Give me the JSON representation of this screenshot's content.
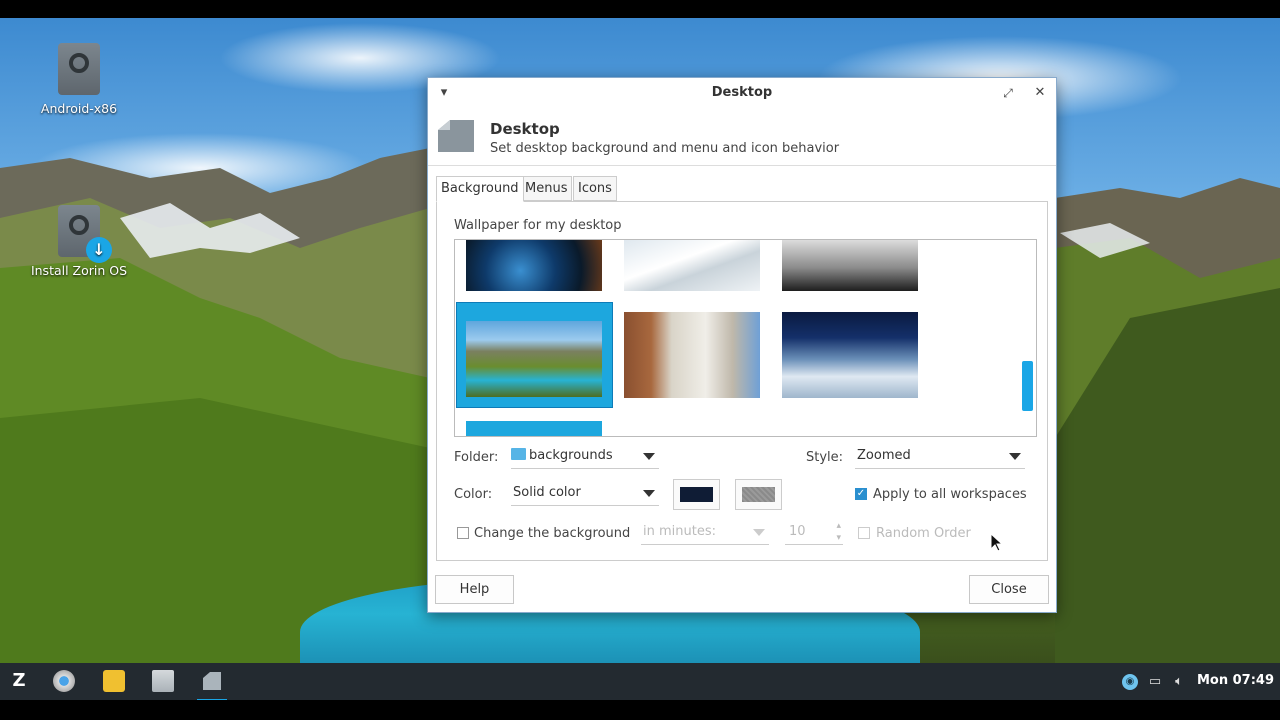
{
  "desktop": {
    "icons": [
      {
        "label": "Android-x86"
      },
      {
        "label": "Install Zorin OS"
      }
    ]
  },
  "window": {
    "title": "Desktop",
    "header_title": "Desktop",
    "header_subtitle": "Set desktop background and menu and icon behavior",
    "tabs": [
      {
        "label": "Background",
        "active": true
      },
      {
        "label": "Menus",
        "active": false
      },
      {
        "label": "Icons",
        "active": false
      }
    ],
    "background": {
      "wallpaper_label": "Wallpaper for my desktop",
      "folder_label": "Folder:",
      "folder_value": "backgrounds",
      "style_label": "Style:",
      "style_value": "Zoomed",
      "color_label": "Color:",
      "color_value": "Solid color",
      "primary_color": "#0f1c35",
      "secondary_color": "#8a8a8a",
      "apply_all_label": "Apply to all workspaces",
      "apply_all_checked": true,
      "change_bg_label": "Change the background",
      "change_bg_checked": false,
      "interval_unit": "in minutes:",
      "interval_value": "10",
      "random_order_label": "Random Order",
      "random_order_checked": false
    },
    "help_label": "Help",
    "close_label": "Close"
  },
  "taskbar": {
    "clock": "Mon 07:49",
    "accent": "#1aa6e6"
  }
}
